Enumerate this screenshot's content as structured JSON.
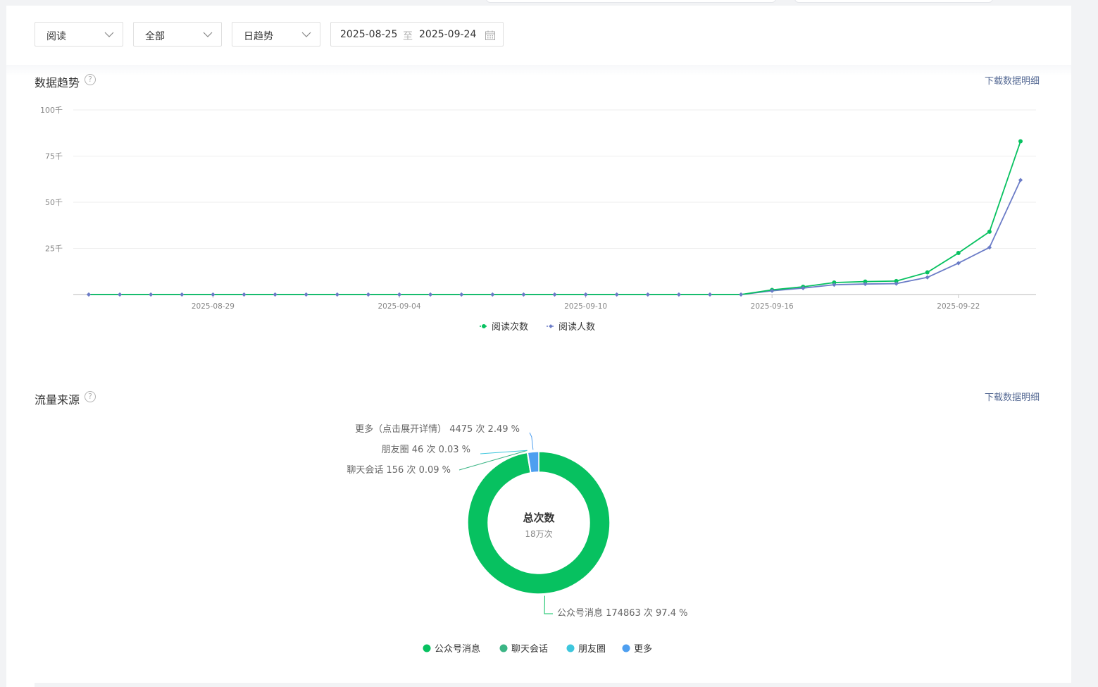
{
  "filters": {
    "metric": "阅读",
    "scope": "全部",
    "granularity": "日趋势",
    "date_start": "2025-08-25",
    "date_separator": "至",
    "date_end": "2025-09-24"
  },
  "trend": {
    "title": "数据趋势",
    "help": "?",
    "download": "下载数据明细"
  },
  "source": {
    "title": "流量来源",
    "help": "?",
    "download": "下载数据明细"
  },
  "colors": {
    "read_count": "#07c160",
    "read_users": "#6b7cc7",
    "gongzhonghao": "#07c160",
    "chat": "#3bb585",
    "moments": "#3ec7dd",
    "more": "#4e9ff0"
  },
  "chart_data": [
    {
      "type": "line",
      "title": "",
      "xlabel": "",
      "ylabel": "",
      "ylim": [
        0,
        100000
      ],
      "yticks": [
        25000,
        50000,
        75000,
        100000
      ],
      "ytick_labels": [
        "25千",
        "50千",
        "75千",
        "100千"
      ],
      "grid": true,
      "legend_position": "bottom",
      "x": [
        "2025-08-25",
        "2025-08-26",
        "2025-08-27",
        "2025-08-28",
        "2025-08-29",
        "2025-08-30",
        "2025-08-31",
        "2025-09-01",
        "2025-09-02",
        "2025-09-03",
        "2025-09-04",
        "2025-09-05",
        "2025-09-06",
        "2025-09-07",
        "2025-09-08",
        "2025-09-09",
        "2025-09-10",
        "2025-09-11",
        "2025-09-12",
        "2025-09-13",
        "2025-09-14",
        "2025-09-15",
        "2025-09-16",
        "2025-09-17",
        "2025-09-18",
        "2025-09-19",
        "2025-09-20",
        "2025-09-21",
        "2025-09-22",
        "2025-09-23",
        "2025-09-24"
      ],
      "xtick_labels": [
        "2025-08-29",
        "2025-09-04",
        "2025-09-10",
        "2025-09-16",
        "2025-09-22"
      ],
      "series": [
        {
          "name": "阅读次数",
          "values": [
            0,
            0,
            0,
            0,
            0,
            0,
            0,
            0,
            0,
            0,
            0,
            0,
            0,
            0,
            0,
            0,
            0,
            0,
            0,
            0,
            0,
            0,
            2500,
            4200,
            6500,
            7000,
            7300,
            12000,
            22500,
            34000,
            83000
          ]
        },
        {
          "name": "阅读人数",
          "values": [
            0,
            0,
            0,
            0,
            0,
            0,
            0,
            0,
            0,
            0,
            0,
            0,
            0,
            0,
            0,
            0,
            0,
            0,
            0,
            0,
            0,
            0,
            2000,
            3500,
            5300,
            5700,
            5900,
            9300,
            17000,
            25500,
            62000
          ]
        }
      ]
    },
    {
      "type": "pie",
      "title": "",
      "center_title": "总次数",
      "center_value": "18万次",
      "legend_position": "bottom",
      "slices": [
        {
          "name": "公众号消息",
          "value": 174863,
          "percent": 97.4,
          "label": "公众号消息 174863 次 97.4 %"
        },
        {
          "name": "聊天会话",
          "value": 156,
          "percent": 0.09,
          "label": "聊天会话 156 次 0.09 %"
        },
        {
          "name": "朋友圈",
          "value": 46,
          "percent": 0.03,
          "label": "朋友圈 46 次 0.03 %"
        },
        {
          "name": "更多",
          "value": 4475,
          "percent": 2.49,
          "label": "更多（点击展开详情） 4475 次 2.49 %"
        }
      ]
    }
  ]
}
